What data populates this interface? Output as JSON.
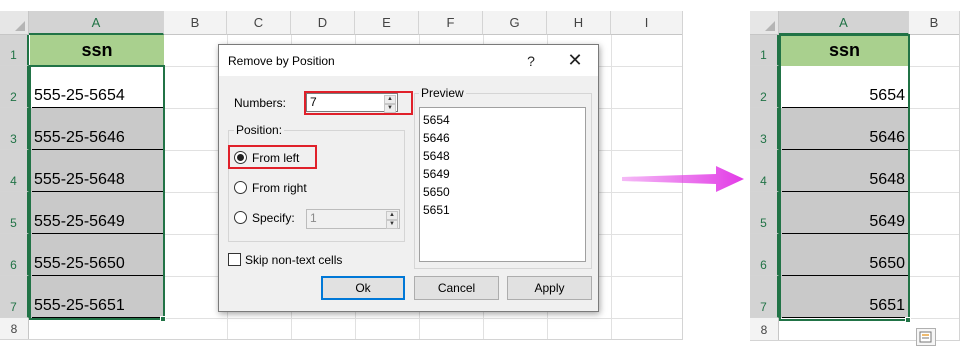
{
  "left_sheet": {
    "col_headers": [
      "A",
      "B",
      "C",
      "D",
      "E",
      "F",
      "G",
      "H",
      "I"
    ],
    "row_headers": [
      "1",
      "2",
      "3",
      "4",
      "5",
      "6",
      "7",
      "8"
    ],
    "header_cell": "ssn",
    "values": [
      "555-25-5654",
      "555-25-5646",
      "555-25-5648",
      "555-25-5649",
      "555-25-5650",
      "555-25-5651"
    ]
  },
  "right_sheet": {
    "col_headers": [
      "A",
      "B"
    ],
    "row_headers": [
      "1",
      "2",
      "3",
      "4",
      "5",
      "6",
      "7",
      "8"
    ],
    "header_cell": "ssn",
    "values": [
      "5654",
      "5646",
      "5648",
      "5649",
      "5650",
      "5651"
    ]
  },
  "dialog": {
    "title": "Remove by Position",
    "help": "?",
    "close": "✕",
    "numbers_label": "Numbers:",
    "numbers_value": "7",
    "position_label": "Position:",
    "from_left": "From left",
    "from_right": "From right",
    "specify": "Specify:",
    "specify_value": "1",
    "skip_non_text": "Skip non-text cells",
    "preview_label": "Preview",
    "preview_items": [
      "5654",
      "5646",
      "5648",
      "5649",
      "5650",
      "5651"
    ],
    "ok": "Ok",
    "cancel": "Cancel",
    "apply": "Apply"
  },
  "colors": {
    "header_fill": "#a9d08e",
    "data_fill": "#c9c9c9",
    "selection": "#217346",
    "highlight": "#e0202a",
    "arrow": "#e23be6"
  },
  "icons": {
    "arrow": "right-arrow-icon",
    "quick_analysis": "quick-analysis-icon"
  }
}
